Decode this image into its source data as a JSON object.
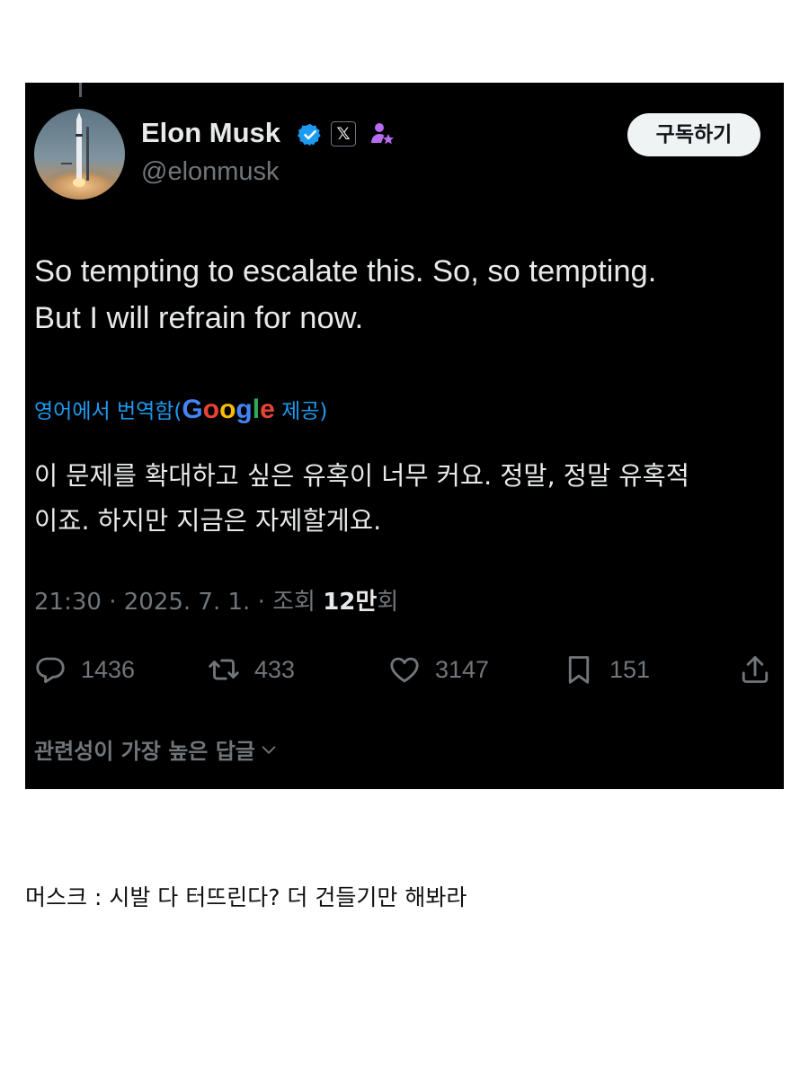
{
  "tweet": {
    "author_name": "Elon Musk",
    "handle": "@elonmusk",
    "subscribe_label": "구독하기",
    "text_line1": "So tempting to escalate this. So, so tempting.",
    "text_line2": "But I will refrain for now.",
    "translated_prefix": "영어에서 번역함(",
    "translated_suffix": " 제공)",
    "google_letters": [
      "G",
      "o",
      "o",
      "g",
      "l",
      "e"
    ],
    "translation_line1": "이 문제를 확대하고 싶은 유혹이 너무 커요. 정말, 정말 유혹적",
    "translation_line2": "이죠. 하지만 지금은 자제할게요.",
    "time": "21:30",
    "date": "2025. 7. 1.",
    "views_label": "조회",
    "views_count": "12만",
    "views_suffix": "회",
    "replies": "1436",
    "reposts": "433",
    "likes": "3147",
    "bookmarks": "151",
    "most_relevant_replies": "관련성이 가장 높은 답글",
    "icons": [
      "verified-badge-icon",
      "x-logo-icon",
      "affiliate-badge-icon",
      "reply-icon",
      "repost-icon",
      "like-icon",
      "bookmark-icon",
      "share-icon",
      "chevron-down-icon"
    ],
    "colors": {
      "background": "#000000",
      "primary_text": "#e7e9ea",
      "secondary_text": "#71767b",
      "link_blue": "#1d9bf0",
      "verified_blue": "#1d9bf0",
      "affiliate_purple": "#b66cf0",
      "google_blue": "#4285f4",
      "google_red": "#ea4335",
      "google_yellow": "#fbbc05",
      "google_green": "#34a853"
    }
  },
  "caption": "머스크 : 시발 다 터뜨린다? 더 건들기만 해봐라"
}
